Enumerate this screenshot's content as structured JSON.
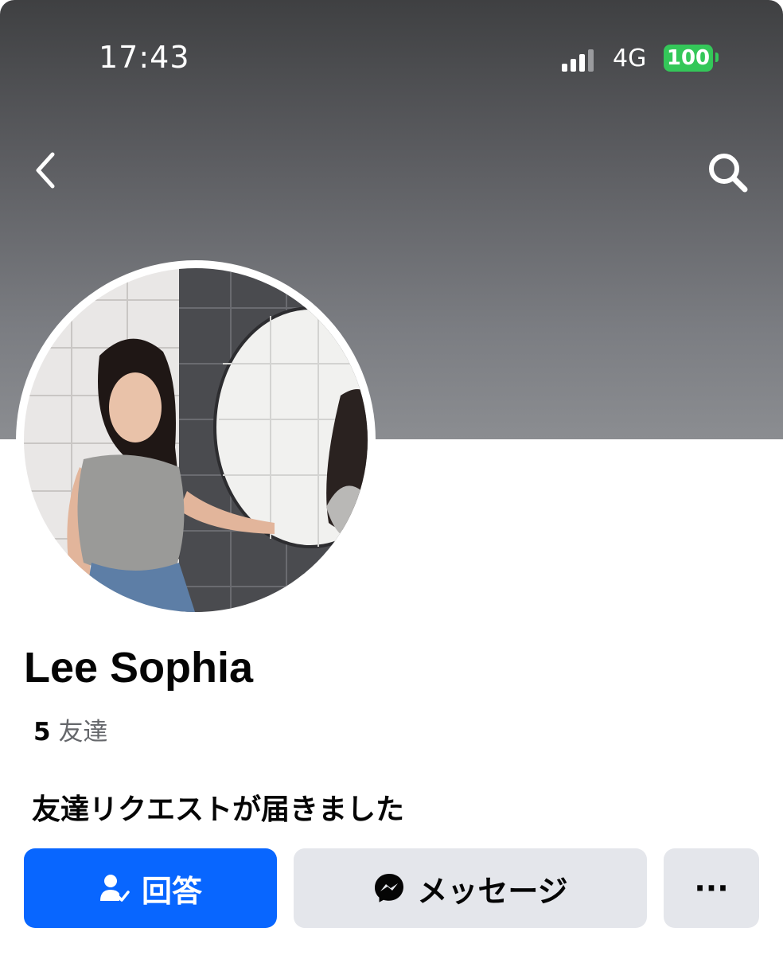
{
  "status_bar": {
    "time": "17:43",
    "network": "4G",
    "battery": "100",
    "signal_bars_filled": 3,
    "signal_bars_total": 4
  },
  "profile": {
    "name": "Lee Sophia",
    "friends_count": "5",
    "friends_label": "友達",
    "request_note": "友達リクエストが届きました"
  },
  "actions": {
    "respond_label": "回答",
    "message_label": "メッセージ",
    "more_label": "···"
  },
  "icons": {
    "back": "chevron-left-icon",
    "search": "search-icon",
    "respond": "person-check-icon",
    "message": "messenger-icon"
  },
  "colors": {
    "primary": "#0866ff",
    "secondary_button": "#e4e6eb",
    "battery": "#34c759"
  }
}
